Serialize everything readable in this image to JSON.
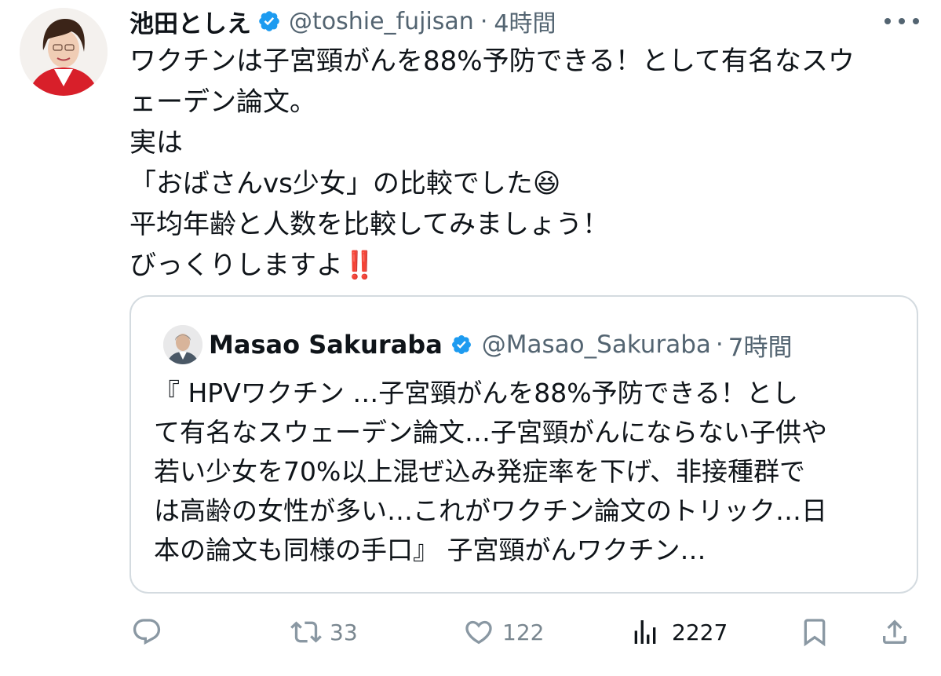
{
  "tweet": {
    "display_name": "池田としえ",
    "handle": "@toshie_fujisan",
    "separator": "·",
    "time": "4時間",
    "lines": [
      "ワクチンは子宮頸がんを88%予防できる！として有名なスウ",
      "ェーデン論文。",
      "実は",
      "「おばさんvs少女」の比較でした😆",
      "平均年齢と人数を比較してみましょう！",
      "びっくりしますよ‼️"
    ]
  },
  "quote": {
    "display_name": "Masao Sakuraba",
    "handle": "@Masao_Sakuraba",
    "separator": "·",
    "time": "7時間",
    "lines": [
      "『 HPVワクチン …子宮頸がんを88%予防できる！とし",
      "て有名なスウェーデン論文…子宮頸がんにならない子供や",
      "若い少女を70%以上混ぜ込み発症率を下げ、非接種群で",
      "は高齢の女性が多い…これがワクチン論文のトリック…日",
      "本の論文も同様の手口』 子宮頸がんワクチン…"
    ]
  },
  "actions": {
    "reply_count": "",
    "retweet_count": "33",
    "like_count": "122",
    "view_count": "2227"
  },
  "icons": {
    "verified": "verified-badge-icon",
    "more": "more-options-icon",
    "reply": "reply-icon",
    "retweet": "retweet-icon",
    "like": "heart-icon",
    "views": "views-bar-chart-icon",
    "bookmark": "bookmark-icon",
    "share": "share-icon"
  },
  "colors": {
    "verified": "#1d9bf0",
    "secondary_text": "#536471",
    "action_icon": "#8a98a3",
    "border": "#d4dbe0"
  }
}
